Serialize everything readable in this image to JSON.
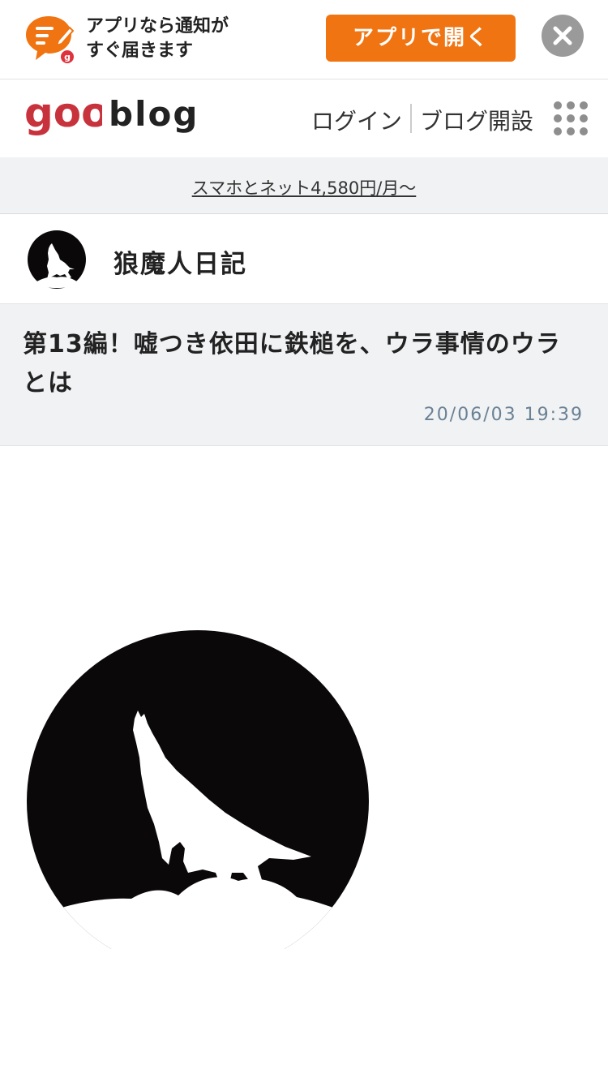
{
  "app_banner": {
    "message_line1": "アプリなら通知が",
    "message_line2": "すぐ届きます",
    "open_button_label": "アプリで開く",
    "accent_color": "#f07411",
    "icon": "goo-blog-app-icon",
    "close_icon": "close-icon"
  },
  "header": {
    "logo_text": "goo",
    "wordmark": "blog",
    "login_label": "ログイン",
    "open_blog_label": "ブログ開設",
    "menu_icon": "grid-menu-icon",
    "logo_color": "#c8323c"
  },
  "ad": {
    "text": "スマホとネット4,580円/月～"
  },
  "blog": {
    "name": "狼魔人日記",
    "avatar": "howling-wolf-avatar"
  },
  "article": {
    "title": "第13編！嘘つき依田に鉄槌を、ウラ事情のウラとは",
    "date": "20/06/03 19:39",
    "image": "howling-wolf-moon-image"
  }
}
